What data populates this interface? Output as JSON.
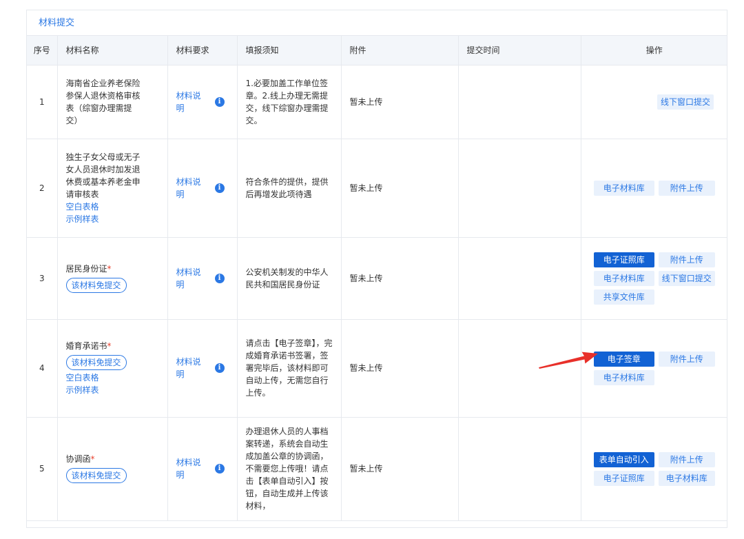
{
  "panel": {
    "title": "材料提交"
  },
  "table": {
    "headers": [
      "序号",
      "材料名称",
      "材料要求",
      "填报须知",
      "附件",
      "提交时间",
      "操作"
    ],
    "rows": [
      {
        "index": "1",
        "name_lines": [
          "海南省企业养老保险",
          "参保人退休资格审核",
          "表（综窗办理需提",
          "交）"
        ],
        "required": "",
        "exempt_label": "",
        "links": [],
        "req_text": "材料说明",
        "notice": "1.必要加盖工作单位签章。2.线上办理无需提交，线下综窗办理需提交。",
        "attachment": "暂未上传",
        "submit_time": "",
        "ops": [
          {
            "label": "线下窗口提交",
            "primary": false
          }
        ]
      },
      {
        "index": "2",
        "name_lines": [
          "独生子女父母或无子",
          "女人员退休时加发退",
          "休费或基本养老金申",
          "请审核表"
        ],
        "required": "",
        "exempt_label": "",
        "links": [
          "空白表格",
          "示例样表"
        ],
        "req_text": "材料说明",
        "notice": "符合条件的提供，提供后再增发此项待遇",
        "attachment": "暂未上传",
        "submit_time": "",
        "ops": [
          {
            "label": "电子材料库",
            "primary": false
          },
          {
            "label": "附件上传",
            "primary": false
          }
        ]
      },
      {
        "index": "3",
        "name_lines": [
          "居民身份证"
        ],
        "required": "*",
        "exempt_label": "该材料免提交",
        "links": [],
        "req_text": "材料说明",
        "notice": "公安机关制发的中华人民共和国居民身份证",
        "attachment": "暂未上传",
        "submit_time": "",
        "ops": [
          {
            "label": "电子证照库",
            "primary": true
          },
          {
            "label": "附件上传",
            "primary": false
          },
          {
            "label": "电子材料库",
            "primary": false
          },
          {
            "label": "线下窗口提交",
            "primary": false
          },
          {
            "label": "共享文件库",
            "primary": false
          }
        ]
      },
      {
        "index": "4",
        "name_lines": [
          "婚育承诺书"
        ],
        "required": "*",
        "exempt_label": "该材料免提交",
        "links": [
          "空白表格",
          "示例样表"
        ],
        "req_text": "材料说明",
        "notice": "请点击【电子签章】，完成婚育承诺书签署，签署完毕后，该材料即可自动上传，无需您自行上传。",
        "attachment": "暂未上传",
        "submit_time": "",
        "ops": [
          {
            "label": "电子签章",
            "primary": true
          },
          {
            "label": "附件上传",
            "primary": false
          },
          {
            "label": "电子材料库",
            "primary": false
          }
        ]
      },
      {
        "index": "5",
        "name_lines": [
          "协调函"
        ],
        "required": "*",
        "exempt_label": "该材料免提交",
        "links": [],
        "req_text": "材料说明",
        "notice": "办理退休人员的人事档案转递，系统会自动生成加盖公章的协调函，不需要您上传哦！请点击【表单自动引入】按钮，自动生成并上传该材料，",
        "attachment": "暂未上传",
        "submit_time": "",
        "ops": [
          {
            "label": "表单自动引入",
            "primary": true
          },
          {
            "label": "附件上传",
            "primary": false
          },
          {
            "label": "电子证照库",
            "primary": false
          },
          {
            "label": "电子材料库",
            "primary": false
          }
        ]
      }
    ]
  },
  "colors": {
    "accent": "#2b78e4",
    "primary_button": "#1262d4",
    "required_mark": "#e8402d",
    "arrow": "#e8302a"
  },
  "icons": {
    "info": "info-icon",
    "annotation": "red-arrow"
  }
}
